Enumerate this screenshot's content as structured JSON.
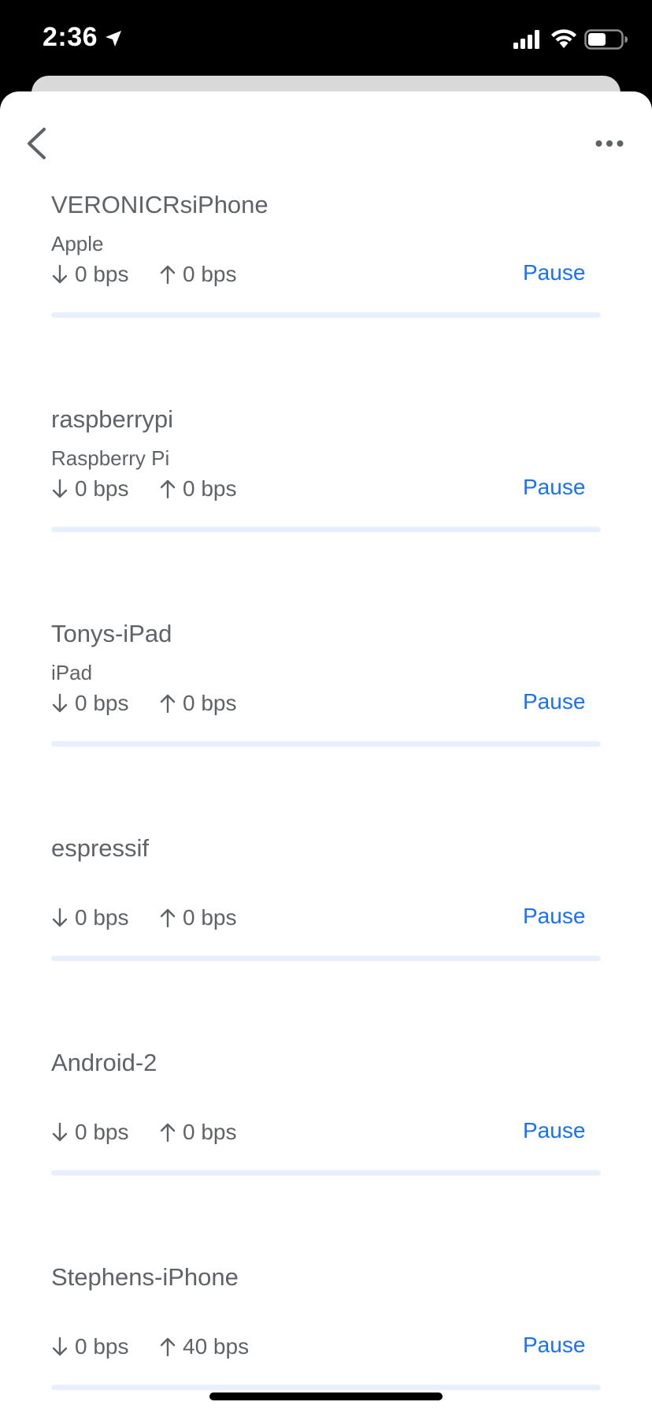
{
  "status_bar": {
    "time": "2:36",
    "icons": [
      "location-arrow-icon",
      "cellular-signal-icon",
      "wifi-icon",
      "battery-icon"
    ]
  },
  "header": {
    "back_icon": "chevron-left-icon",
    "more_icon": "more-horizontal-icon"
  },
  "colors": {
    "text": "#5f6368",
    "accent": "#1a73e8",
    "usage_bar": "#e8f0fe"
  },
  "devices": [
    {
      "name": "VERONICRsiPhone",
      "vendor": "Apple",
      "download": "0 bps",
      "upload": "0 bps",
      "action": "Pause"
    },
    {
      "name": "raspberrypi",
      "vendor": "Raspberry Pi",
      "download": "0 bps",
      "upload": "0 bps",
      "action": "Pause"
    },
    {
      "name": "Tonys-iPad",
      "vendor": "iPad",
      "download": "0 bps",
      "upload": "0 bps",
      "action": "Pause"
    },
    {
      "name": "espressif",
      "vendor": "",
      "download": "0 bps",
      "upload": "0 bps",
      "action": "Pause"
    },
    {
      "name": "Android-2",
      "vendor": "",
      "download": "0 bps",
      "upload": "0 bps",
      "action": "Pause"
    },
    {
      "name": "Stephens-iPhone",
      "vendor": "",
      "download": "0 bps",
      "upload": "40 bps",
      "action": "Pause"
    }
  ]
}
